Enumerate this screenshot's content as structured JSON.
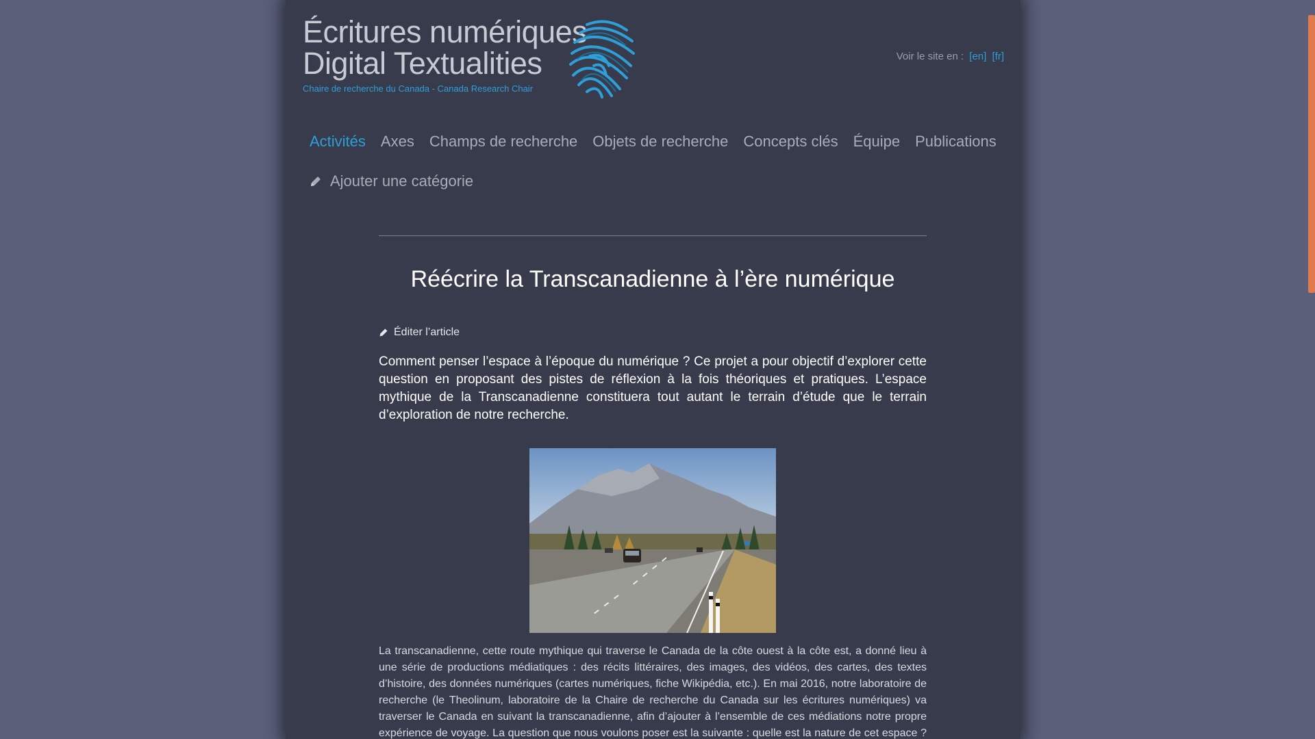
{
  "header": {
    "logo_line1": "Écritures numériques",
    "logo_line2": "Digital Textualities",
    "logo_subtitle": "Chaire de recherche du Canada - Canada Research Chair",
    "lang_label": "Voir le site en :",
    "lang_en": "[en]",
    "lang_fr": "[fr]"
  },
  "nav": {
    "items": [
      "Activités",
      "Axes",
      "Champs de recherche",
      "Objets de recherche",
      "Concepts clés",
      "Équipe",
      "Publications"
    ],
    "active": "Activités",
    "add_category": "Ajouter une catégorie"
  },
  "article": {
    "title": "Réécrire la Transcanadienne à l’ère numérique",
    "edit_label": "Éditer l’article",
    "lead": "Comment penser l’espace à l’époque du numérique ? Ce projet a pour objectif d’explorer cette question en proposant des pistes de réflexion à la fois théoriques et pratiques. L’espace mythique de la Transcanadienne constituera tout autant le terrain d’étude que le terrain d’exploration de notre recherche.",
    "body": "La transcanadienne, cette route mythique qui traverse le Canada de la côte ouest à la côte est, a donné lieu à une série de productions médiatiques : des récits littéraires, des images, des vidéos, des cartes, des textes d’histoire, des données numériques (cartes numériques, fiche Wikipédia, etc.). En mai 2016, notre laboratoire de recherche (le Theolinum, laboratoire de la Chaire de recherche du Canada sur les écritures numériques) va traverser le Canada en suivant la transcanadienne, afin d’ajouter à l’ensemble de ces médiations notre propre expérience de voyage. La question que nous voulons poser est la suivante : quelle est la nature de cet espace ? Que représente-t-il et com-"
  },
  "colors": {
    "background": "#5a5f7a",
    "page": "#373b4b",
    "accent": "#2f9fd8",
    "scroll_thumb": "#e07a4c"
  }
}
